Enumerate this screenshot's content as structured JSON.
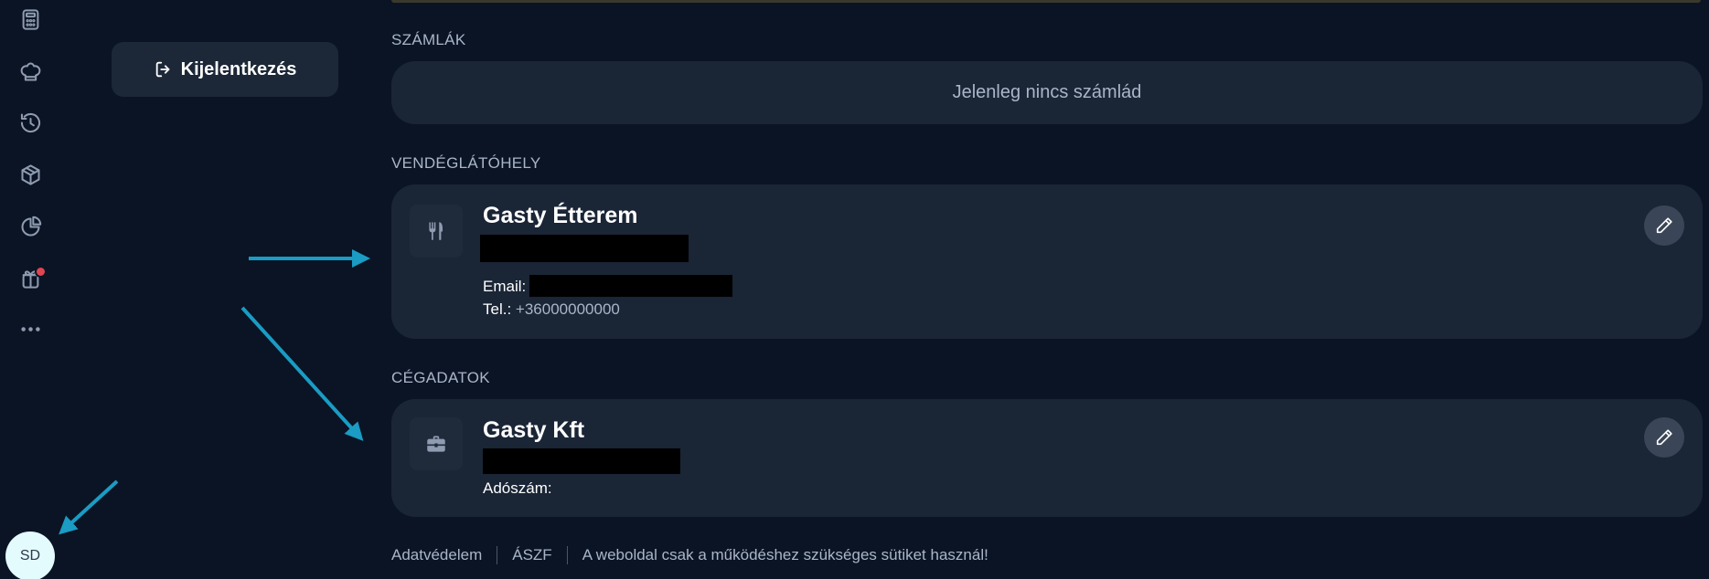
{
  "sidebar": {
    "icons": [
      {
        "name": "calculator-icon"
      },
      {
        "name": "chef-hat-icon"
      },
      {
        "name": "history-icon"
      },
      {
        "name": "box-icon"
      },
      {
        "name": "pie-chart-icon"
      },
      {
        "name": "gift-icon",
        "has_notification": true
      },
      {
        "name": "more-icon"
      }
    ],
    "avatar_initials": "SD"
  },
  "logout": {
    "label": "Kijelentkezés"
  },
  "invoices": {
    "section_label": "SZÁMLÁK",
    "empty_text": "Jelenleg nincs számlád"
  },
  "venue": {
    "section_label": "VENDÉGLÁTÓHELY",
    "name": "Gasty Étterem",
    "email_label": "Email:",
    "phone_label": "Tel.:",
    "phone_value": "+36000000000"
  },
  "company": {
    "section_label": "CÉGADATOK",
    "name": "Gasty Kft",
    "tax_label": "Adószám:"
  },
  "footer": {
    "privacy": "Adatvédelem",
    "terms": "ÁSZF",
    "cookie_notice": "A weboldal csak a működéshez szükséges sütiket használ!"
  },
  "colors": {
    "background": "#0b1424",
    "card": "#1a2536",
    "annotation_arrow": "#1a9cc4",
    "notification": "#e14552"
  }
}
